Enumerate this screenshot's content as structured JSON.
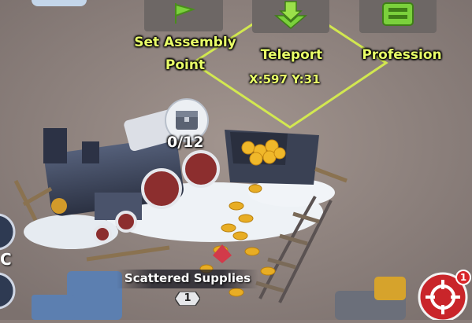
{
  "actions": {
    "assembly_line1": "Set Assembly",
    "assembly_line2": "Point",
    "teleport": "Teleport",
    "profession": "Profession"
  },
  "tile": {
    "coordinates": "X:597 Y:31"
  },
  "supply": {
    "capacity": "0/12",
    "name": "Scattered Supplies",
    "level": "1"
  },
  "hud": {
    "alert_count": "1",
    "left_edge_letter": "C"
  },
  "colors": {
    "label_yellow": "#e9ff69",
    "ground": "#8a7e7a",
    "icon_green": "#7bd13c",
    "alert_red": "#d8262a"
  }
}
